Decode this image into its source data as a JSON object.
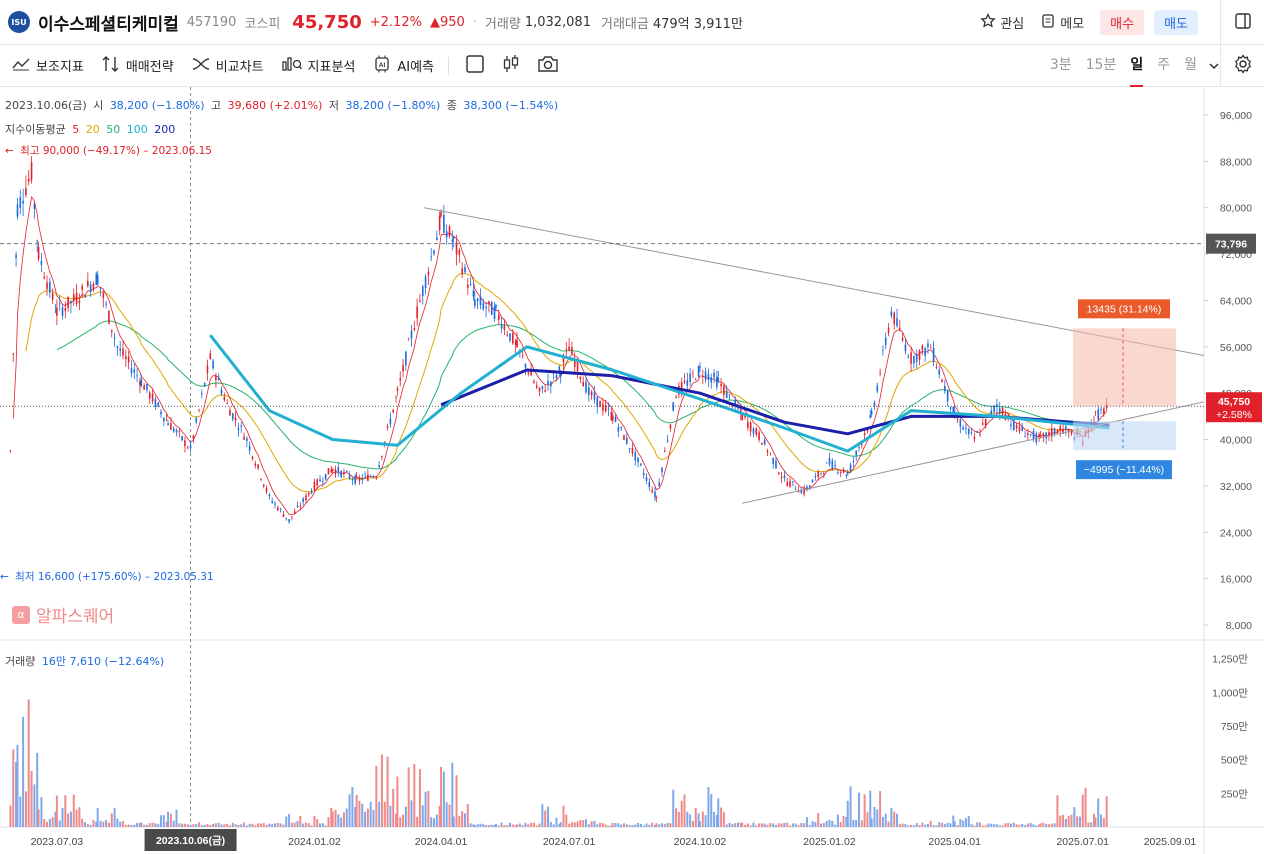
{
  "header": {
    "logo_text": "ISU",
    "stock_name": "이수스페셜티케미컬",
    "stock_code": "457190",
    "market": "코스피",
    "price": "45,750",
    "change_pct": "+2.12%",
    "change_abs": "▲950",
    "volume_label": "거래량",
    "volume_value": "1,032,081",
    "amount_label": "거래대금",
    "amount_value": "479억 3,911만",
    "watch_label": "관심",
    "memo_label": "메모",
    "buy_label": "매수",
    "sell_label": "매도"
  },
  "toolbar": {
    "items": [
      {
        "label": "보조지표",
        "icon": "indicator-icon"
      },
      {
        "label": "매매전략",
        "icon": "strategy-icon"
      },
      {
        "label": "비교차트",
        "icon": "compare-icon"
      },
      {
        "label": "지표분석",
        "icon": "analysis-icon"
      },
      {
        "label": "AI예측",
        "icon": "ai-icon"
      }
    ],
    "periods": [
      "3분",
      "15분",
      "일",
      "주",
      "월"
    ],
    "active_period": "일"
  },
  "ohlc": {
    "date": "2023.10.06(금)",
    "open_label": "시",
    "open": "38,200 (−1.80%)",
    "high_label": "고",
    "high": "39,680 (+2.01%)",
    "low_label": "저",
    "low": "38,200 (−1.80%)",
    "close_label": "종",
    "close": "38,300 (−1.54%)"
  },
  "ma": {
    "label": "지수이동평균",
    "periods": [
      {
        "p": "5",
        "color": "#e0202a"
      },
      {
        "p": "20",
        "color": "#e0a800"
      },
      {
        "p": "50",
        "color": "#26b36a"
      },
      {
        "p": "100",
        "color": "#22b0d0"
      },
      {
        "p": "200",
        "color": "#1c1fa8"
      }
    ]
  },
  "annotations": {
    "high": "최고 90,000 (−49.17%) – 2023.06.15",
    "low": "최저 16,600 (+175.60%) – 2023.05.31",
    "target_up": "13435 (31.14%)",
    "target_down": "−4995 (−11.44%)",
    "hline": "73,796",
    "current": "45,750",
    "current_pct": "+2.58%"
  },
  "price_axis": [
    "96,000",
    "88,000",
    "80,000",
    "72,000",
    "64,000",
    "56,000",
    "48,000",
    "40,000",
    "32,000",
    "24,000",
    "16,000",
    "8,000"
  ],
  "volume_axis": [
    "1,250만",
    "1,000만",
    "750만",
    "500만",
    "250만"
  ],
  "volume_info": {
    "label": "거래량",
    "value": "16만 7,610 (−12.64%)"
  },
  "date_axis": [
    "2023.07.03",
    "2024.01.02",
    "2024.04.01",
    "2024.07.01",
    "2024.10.02",
    "2025.01.02",
    "2025.04.01",
    "2025.07.01",
    "2025.09.01"
  ],
  "crosshair_date": "2023.10.06(금)",
  "watermark": "알파스퀘어",
  "colors": {
    "up": "#e0202a",
    "down": "#1b6ae0",
    "brand": "#1d4fa3"
  },
  "chart_data": {
    "type": "candlestick",
    "title": "",
    "xlabel": "",
    "ylabel": "",
    "ylim": [
      4000,
      100000
    ],
    "x_range": [
      "2023.05",
      "2025.09"
    ],
    "price_points": [
      [
        "2023.05.31",
        38000
      ],
      [
        "2023.06.05",
        80000
      ],
      [
        "2023.06.15",
        86000
      ],
      [
        "2023.06.20",
        72000
      ],
      [
        "2023.07.03",
        62000
      ],
      [
        "2023.07.15",
        64000
      ],
      [
        "2023.08.01",
        68000
      ],
      [
        "2023.08.15",
        56000
      ],
      [
        "2023.09.01",
        50000
      ],
      [
        "2023.09.20",
        43000
      ],
      [
        "2023.10.06",
        38300
      ],
      [
        "2023.10.20",
        54000
      ],
      [
        "2023.11.01",
        46000
      ],
      [
        "2023.11.15",
        40000
      ],
      [
        "2023.12.01",
        30000
      ],
      [
        "2023.12.15",
        26000
      ],
      [
        "2024.01.02",
        32000
      ],
      [
        "2024.01.15",
        35000
      ],
      [
        "2024.02.01",
        33000
      ],
      [
        "2024.02.15",
        34000
      ],
      [
        "2024.03.01",
        48000
      ],
      [
        "2024.03.15",
        62000
      ],
      [
        "2024.04.01",
        78000
      ],
      [
        "2024.04.10",
        74000
      ],
      [
        "2024.04.25",
        64000
      ],
      [
        "2024.05.10",
        62000
      ],
      [
        "2024.05.25",
        56000
      ],
      [
        "2024.06.10",
        48000
      ],
      [
        "2024.06.25",
        52000
      ],
      [
        "2024.07.01",
        56000
      ],
      [
        "2024.07.15",
        48000
      ],
      [
        "2024.08.01",
        44000
      ],
      [
        "2024.08.15",
        38000
      ],
      [
        "2024.09.01",
        30000
      ],
      [
        "2024.09.15",
        48000
      ],
      [
        "2024.10.02",
        52000
      ],
      [
        "2024.10.15",
        50000
      ],
      [
        "2024.11.01",
        44000
      ],
      [
        "2024.11.15",
        40000
      ],
      [
        "2024.12.01",
        33000
      ],
      [
        "2024.12.15",
        31000
      ],
      [
        "2025.01.02",
        36000
      ],
      [
        "2025.01.15",
        34000
      ],
      [
        "2025.02.01",
        44000
      ],
      [
        "2025.02.15",
        62000
      ],
      [
        "2025.03.01",
        54000
      ],
      [
        "2025.03.15",
        56000
      ],
      [
        "2025.04.01",
        44000
      ],
      [
        "2025.04.15",
        40000
      ],
      [
        "2025.05.01",
        46000
      ],
      [
        "2025.05.15",
        42000
      ],
      [
        "2025.06.01",
        40000
      ],
      [
        "2025.06.15",
        42000
      ],
      [
        "2025.07.01",
        40000
      ],
      [
        "2025.07.10",
        44000
      ],
      [
        "2025.07.20",
        45750
      ]
    ],
    "ma_series": [
      {
        "name": "200",
        "values": [
          [
            "2024.04.01",
            46000
          ],
          [
            "2024.06.01",
            52000
          ],
          [
            "2024.08.01",
            51000
          ],
          [
            "2024.10.02",
            48000
          ],
          [
            "2024.12.01",
            43000
          ],
          [
            "2025.01.15",
            41000
          ],
          [
            "2025.03.01",
            44000
          ],
          [
            "2025.05.01",
            44000
          ],
          [
            "2025.07.20",
            42500
          ]
        ]
      },
      {
        "name": "100",
        "values": [
          [
            "2023.10.20",
            58000
          ],
          [
            "2023.12.01",
            45000
          ],
          [
            "2024.01.15",
            40000
          ],
          [
            "2024.03.01",
            39000
          ],
          [
            "2024.04.15",
            48000
          ],
          [
            "2024.06.01",
            56000
          ],
          [
            "2024.08.01",
            52000
          ],
          [
            "2024.10.02",
            47000
          ],
          [
            "2024.12.01",
            42000
          ],
          [
            "2025.01.15",
            38000
          ],
          [
            "2025.03.01",
            45000
          ],
          [
            "2025.05.01",
            44000
          ],
          [
            "2025.07.20",
            42000
          ]
        ]
      }
    ],
    "volume": [
      [
        "2023.06",
        1200
      ],
      [
        "2023.07",
        400
      ],
      [
        "2023.08",
        180
      ],
      [
        "2023.10",
        160
      ],
      [
        "2024.01",
        120
      ],
      [
        "2024.02",
        700
      ],
      [
        "2024.03",
        680
      ],
      [
        "2024.04",
        580
      ],
      [
        "2024.07",
        200
      ],
      [
        "2024.10",
        400
      ],
      [
        "2025.01",
        150
      ],
      [
        "2025.02",
        400
      ],
      [
        "2025.04",
        120
      ],
      [
        "2025.07",
        350
      ]
    ],
    "trendlines": [
      {
        "name": "upper",
        "from": [
          "2024.03.20",
          80000
        ],
        "to": [
          "2025.09.05",
          54500
        ]
      },
      {
        "name": "lower",
        "from": [
          "2024.11.01",
          29000
        ],
        "to": [
          "2025.09.05",
          46500
        ]
      }
    ]
  }
}
